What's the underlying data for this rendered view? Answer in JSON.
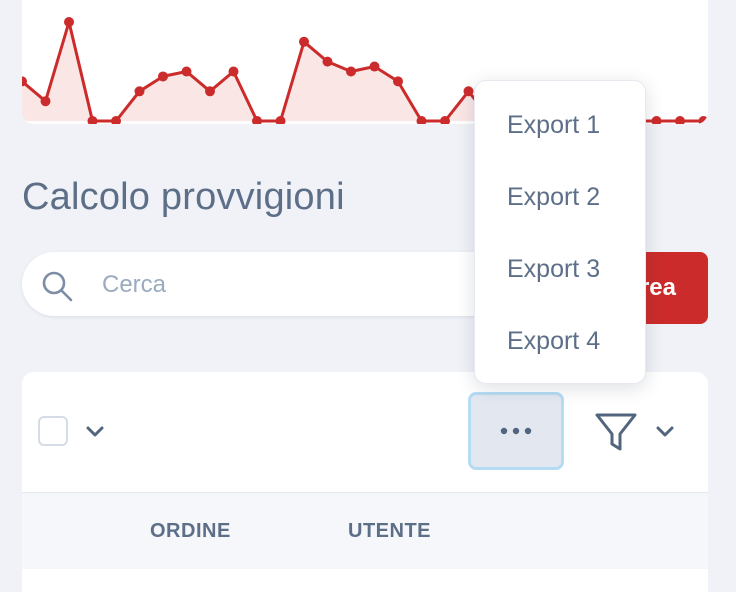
{
  "chart_data": {
    "type": "area",
    "color": "#cc2b2b",
    "fill": "#fbe6e6",
    "values": [
      4,
      2,
      10,
      0,
      0,
      3,
      4.5,
      5,
      3,
      5,
      0,
      0,
      8,
      6,
      5,
      5.5,
      4,
      0,
      0,
      3,
      0,
      0,
      0,
      0,
      0,
      0,
      0,
      0,
      0,
      0
    ],
    "ylim": [
      0,
      10
    ]
  },
  "page": {
    "title": "Calcolo provvigioni"
  },
  "search": {
    "placeholder": "Cerca",
    "icon": "search-icon"
  },
  "toolbar": {
    "create_label": "Crea",
    "more_icon": "ellipsis-icon",
    "filter_icon": "filter-icon"
  },
  "export_menu": {
    "items": [
      "Export 1",
      "Export 2",
      "Export 3",
      "Export 4"
    ]
  },
  "table": {
    "columns": [
      "ORDINE",
      "UTENTE"
    ]
  },
  "colors": {
    "accent": "#cc2b2b",
    "focus_ring": "#b6dcf4",
    "text": "#5d6f88",
    "background": "#f0f2f7"
  }
}
